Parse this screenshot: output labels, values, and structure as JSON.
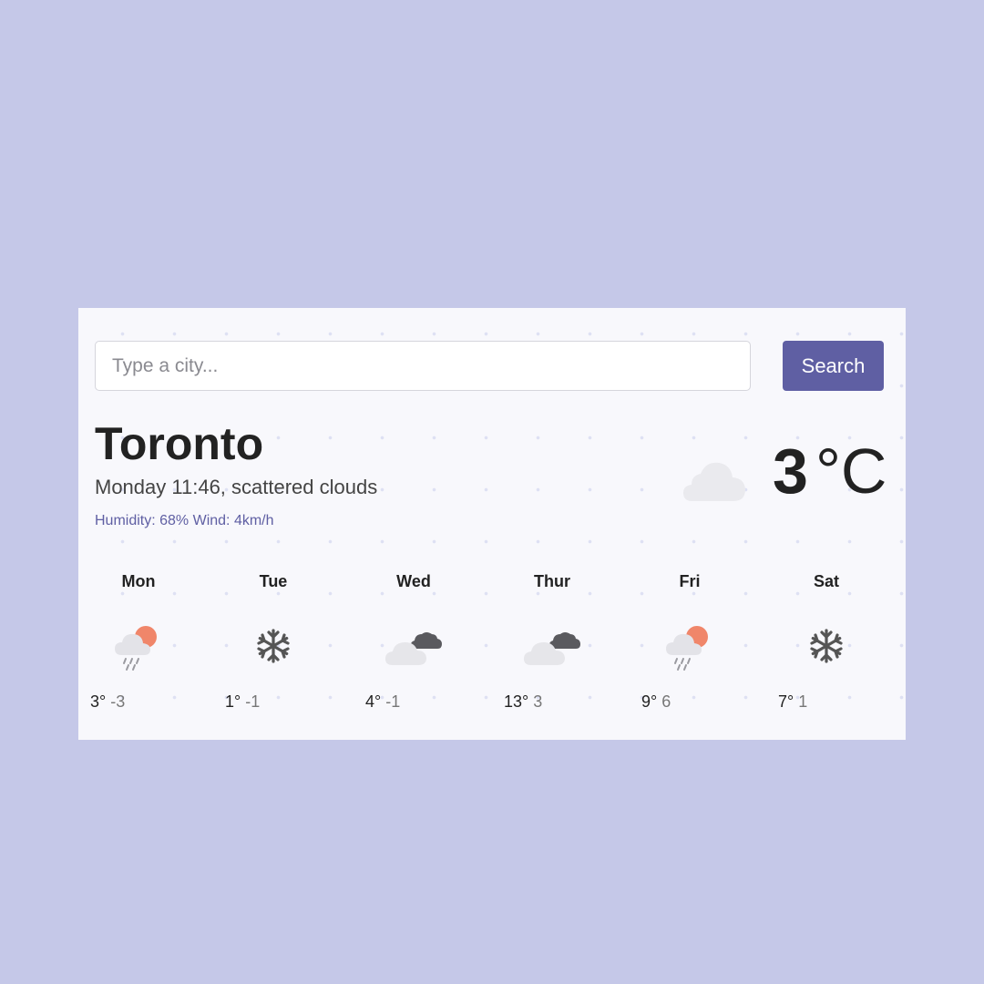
{
  "search": {
    "placeholder": "Type a city...",
    "button_label": "Search"
  },
  "current": {
    "city": "Toronto",
    "description": "Monday 11:46, scattered clouds",
    "humidity_wind": "Humidity: 68% Wind: 4km/h",
    "temperature": "3",
    "unit": "°C",
    "icon": "scattered-clouds-icon"
  },
  "forecast": [
    {
      "day": "Mon",
      "max": "3°",
      "min": "-3",
      "icon": "rain-sun-icon"
    },
    {
      "day": "Tue",
      "max": "1°",
      "min": "-1",
      "icon": "snowflake-icon"
    },
    {
      "day": "Wed",
      "max": "4°",
      "min": "-1",
      "icon": "broken-clouds-icon"
    },
    {
      "day": "Thur",
      "max": "13°",
      "min": "3",
      "icon": "broken-clouds-icon"
    },
    {
      "day": "Fri",
      "max": "9°",
      "min": "6",
      "icon": "rain-sun-icon"
    },
    {
      "day": "Sat",
      "max": "7°",
      "min": "1",
      "icon": "snowflake-icon"
    }
  ],
  "colors": {
    "background": "#c5c8e8",
    "card": "#f8f8fc",
    "accent": "#5f5fa3",
    "sun": "#f0866a"
  }
}
